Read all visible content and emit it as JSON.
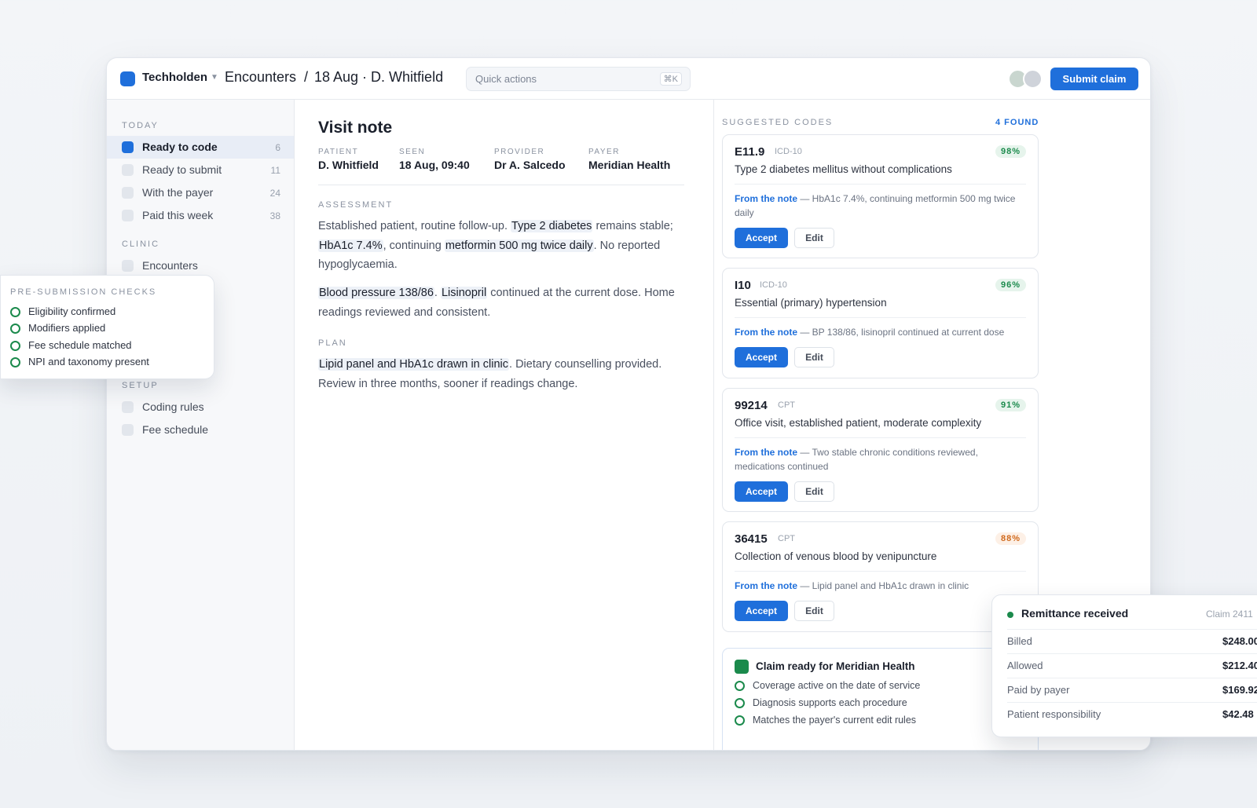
{
  "topbar": {
    "brand": "Techholden",
    "crumb_section": "Encounters",
    "crumb_sep": "/",
    "crumb_page": "18 Aug · D. Whitfield",
    "search_placeholder": "Quick actions",
    "search_shortcut": "⌘K",
    "submit_label": "Submit claim"
  },
  "sidebar": {
    "today_heading": "TODAY",
    "today_items": [
      {
        "label": "Ready to code",
        "count": "6",
        "active": true
      },
      {
        "label": "Ready to submit",
        "count": "11"
      },
      {
        "label": "With the payer",
        "count": "24"
      },
      {
        "label": "Paid this week",
        "count": "38"
      }
    ],
    "clinic_heading": "CLINIC",
    "clinic_items": [
      {
        "label": "Encounters"
      }
    ],
    "setup_heading": "SETUP",
    "setup_items": [
      {
        "label": "Coding rules"
      },
      {
        "label": "Fee schedule"
      }
    ]
  },
  "note": {
    "title": "Visit note",
    "meta": [
      {
        "label": "PATIENT",
        "value": "D. Whitfield"
      },
      {
        "label": "SEEN",
        "value": "18 Aug, 09:40"
      },
      {
        "label": "PROVIDER",
        "value": "Dr A. Salcedo"
      },
      {
        "label": "PAYER",
        "value": "Meridian Health"
      }
    ],
    "assessment_heading": "ASSESSMENT",
    "assessment_p1": {
      "t1": "Established patient, routine follow-up. ",
      "h1": "Type 2 diabetes",
      "t2": " remains stable; ",
      "h2": "HbA1c 7.4%",
      "t3": ", continuing ",
      "h3": "metformin 500 mg twice daily",
      "t4": ". No reported hypoglycaemia."
    },
    "assessment_p2": {
      "h1": "Blood pressure 138/86",
      "t1": ". ",
      "h2": "Lisinopril",
      "t2": " continued at the current dose. Home readings reviewed and consistent."
    },
    "plan_heading": "PLAN",
    "plan_p": {
      "h1": "Lipid panel and HbA1c drawn in clinic",
      "t1": ". Dietary counselling provided. Review in three months, sooner if readings change."
    }
  },
  "codes": {
    "heading": "SUGGESTED CODES",
    "count": "4 FOUND",
    "from_label": "From the note",
    "accept_label": "Accept",
    "edit_label": "Edit",
    "items": [
      {
        "code": "E11.9",
        "system": "ICD-10",
        "confidence": "98%",
        "description": "Type 2 diabetes mellitus without complications",
        "evidence": "— HbA1c 7.4%, continuing metformin 500 mg twice daily"
      },
      {
        "code": "I10",
        "system": "ICD-10",
        "confidence": "96%",
        "description": "Essential (primary) hypertension",
        "evidence": "— BP 138/86, lisinopril continued at current dose"
      },
      {
        "code": "99214",
        "system": "CPT",
        "confidence": "91%",
        "description": "Office visit, established patient, moderate complexity",
        "evidence": "— Two stable chronic conditions reviewed, medications continued"
      },
      {
        "code": "36415",
        "system": "CPT",
        "confidence": "88%",
        "description": "Collection of venous blood by venipuncture",
        "evidence": "— Lipid panel and HbA1c drawn in clinic"
      }
    ]
  },
  "claim": {
    "title": "Claim ready for Meridian Health",
    "checks": [
      "Coverage active on the date of service",
      "Diagnosis supports each procedure",
      "Matches the payer's current edit rules"
    ]
  },
  "pre_submission": {
    "heading": "PRE-SUBMISSION CHECKS",
    "items": [
      "Eligibility confirmed",
      "Modifiers applied",
      "Fee schedule matched",
      "NPI and taxonomy present"
    ]
  },
  "remittance": {
    "title": "Remittance received",
    "claim_id": "Claim 2411",
    "rows": [
      {
        "label": "Billed",
        "value": "$248.00"
      },
      {
        "label": "Allowed",
        "value": "$212.40"
      },
      {
        "label": "Paid by payer",
        "value": "$169.92"
      },
      {
        "label": "Patient responsibility",
        "value": "$42.48"
      }
    ]
  },
  "colors": {
    "accent": "#1f6fdb",
    "success": "#1b8a4c",
    "warning": "#d0691c"
  }
}
